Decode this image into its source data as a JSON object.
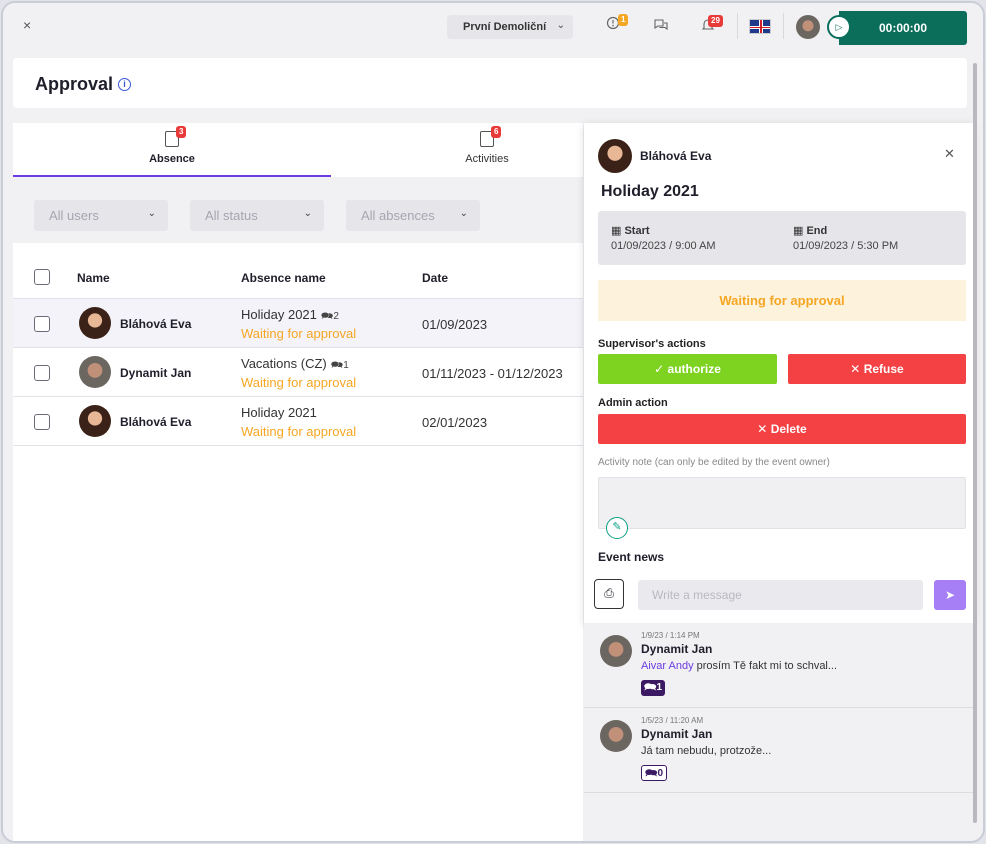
{
  "topbar": {
    "close_label": "×",
    "company": "První Demoliční",
    "alerts_count": "1",
    "notifications_count": "29",
    "timer": "00:00:00"
  },
  "page": {
    "title": "Approval",
    "info_icon": "i"
  },
  "tabs": [
    {
      "label": "Absence",
      "count": "3"
    },
    {
      "label": "Activities",
      "count": "6"
    }
  ],
  "filters": [
    {
      "placeholder": "All users"
    },
    {
      "placeholder": "All status"
    },
    {
      "placeholder": "All absences"
    }
  ],
  "table": {
    "columns": [
      "Name",
      "Absence name",
      "Date"
    ],
    "rows": [
      {
        "name": "Bláhová Eva",
        "absence": "Holiday 2021",
        "comments": "2",
        "status": "Waiting for approval",
        "date": "01/09/2023"
      },
      {
        "name": "Dynamit Jan",
        "absence": "Vacations (CZ)",
        "comments": "1",
        "status": "Waiting for approval",
        "date": "01/11/2023 - 01/12/2023"
      },
      {
        "name": "Bláhová Eva",
        "absence": "Holiday 2021",
        "comments": "",
        "status": "Waiting for approval",
        "date": "02/01/2023"
      }
    ]
  },
  "detail": {
    "user": "Bláhová Eva",
    "title": "Holiday 2021",
    "start_label": "Start",
    "start_value": "01/09/2023 / 9:00 AM",
    "end_label": "End",
    "end_value": "01/09/2023 / 5:30 PM",
    "status": "Waiting for approval",
    "supervisor_label": "Supervisor's actions",
    "authorize_label": "authorize",
    "refuse_label": "Refuse",
    "admin_label": "Admin action",
    "delete_label": "Delete",
    "note_label": "Activity note (can only be edited by the event owner)",
    "news_label": "Event news",
    "message_placeholder": "Write a message"
  },
  "news": [
    {
      "time": "1/9/23 / 1:14 PM",
      "author": "Dynamit Jan",
      "mention": "Aivar Andy",
      "text": " prosím Tě fakt mi to schval...",
      "replies": "1"
    },
    {
      "time": "1/5/23 / 11:20 AM",
      "author": "Dynamit Jan",
      "mention": "",
      "text": "Já tam nebudu, protzože...",
      "replies": "0"
    }
  ],
  "colors": {
    "accent": "#6b3ce0",
    "timer": "#0b6e5b",
    "approve": "#7ed321",
    "refuse": "#f44144",
    "pending": "#f5a623"
  }
}
